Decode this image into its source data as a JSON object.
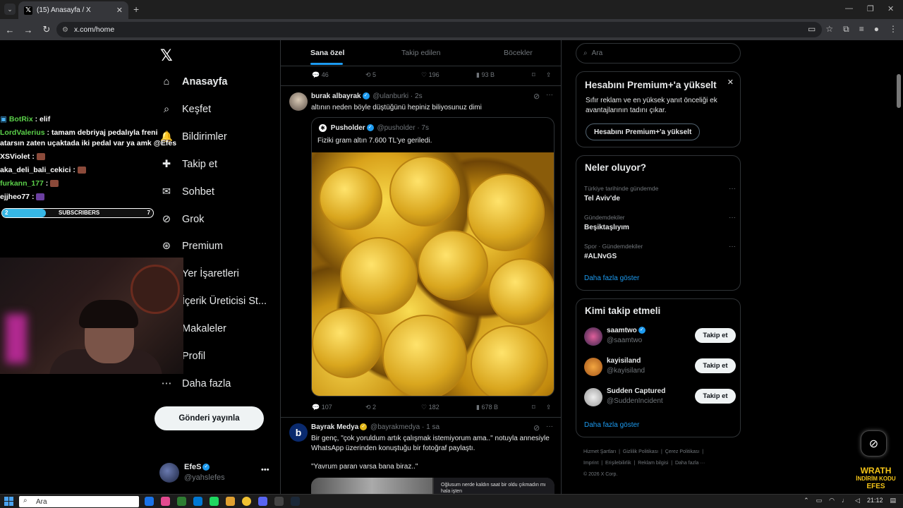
{
  "browser": {
    "tab_title": "(15) Anasayfa / X",
    "url_site": "⚙",
    "url": "x.com/home"
  },
  "overlay": {
    "chat": [
      {
        "user": "BotRix",
        "msg": ": elif"
      },
      {
        "user": "LordValerius",
        "msg": ": tamam debriyaj pedalıyla freni atarsın zaten uçaktada iki pedal var ya amk @Efes"
      },
      {
        "user": "XSViolet",
        "msg": ":"
      },
      {
        "user": "aka_deli_bali_cekici",
        "msg": ":"
      },
      {
        "user": "furkann_177",
        "msg": ":"
      },
      {
        "user": "ejjheo77",
        "msg": ":"
      }
    ],
    "subs_label": "SUBSCRIBERS",
    "subs_current": "2",
    "subs_goal": "7",
    "subs_progress": 0.29,
    "watermark": [
      "WRATH",
      "İNDİRİM KODU",
      "EFES"
    ]
  },
  "nav": {
    "items": [
      {
        "label": "Anasayfa",
        "icon": "home-icon"
      },
      {
        "label": "Keşfet",
        "icon": "search-icon"
      },
      {
        "label": "Bildirimler",
        "icon": "bell-icon"
      },
      {
        "label": "Takip et",
        "icon": "follow-icon"
      },
      {
        "label": "Sohbet",
        "icon": "mail-icon"
      },
      {
        "label": "Grok",
        "icon": "grok-icon"
      },
      {
        "label": "Premium",
        "icon": "premium-icon"
      },
      {
        "label": "Yer İşaretleri",
        "icon": "bookmark-icon"
      },
      {
        "label": "İçerik Üreticisi St...",
        "icon": "studio-icon"
      },
      {
        "label": "Makaleler",
        "icon": "article-icon"
      },
      {
        "label": "Profil",
        "icon": "profile-icon"
      },
      {
        "label": "Daha fazla",
        "icon": "more-icon"
      }
    ],
    "post_button": "Gönderi yayınla",
    "profile_name": "EfeS",
    "profile_handle": "@yahslefes"
  },
  "timeline": {
    "tabs": [
      "Sana özel",
      "Takip edilen",
      "Böcekler"
    ],
    "top_actions": {
      "replies": "46",
      "reposts": "5",
      "likes": "196",
      "views": "93 B"
    },
    "tweet1": {
      "name": "burak albayrak",
      "handle": "@ulanburki",
      "time": "· 2s",
      "text": "altının neden böyle düştüğünü hepiniz biliyosunuz dimi",
      "quote_name": "Pusholder",
      "quote_handle": "@pusholder",
      "quote_time": "· 7s",
      "quote_text": "Fiziki gram altın 7.600 TL'ye geriledi.",
      "replies": "107",
      "reposts": "2",
      "likes": "182",
      "views": "678 B"
    },
    "tweet2": {
      "name": "Bayrak Medya",
      "handle": "@bayrakmedya",
      "time": "· 1 sa",
      "text": "Bir genç, \"çok yoruldum artık çalışmak istemiyorum ama..\" notuyla annesiyle WhatsApp üzerinden konuştuğu bir fotoğraf paylaştı.",
      "text2": "\"Yavrum paran varsa bana biraz..\"",
      "img_caption": "Oğlusum nerde kaldın saat bir oldu çıkmadın mı hala işten"
    }
  },
  "sidebar": {
    "search_placeholder": "Ara",
    "premium_title": "Hesabını Premium+'a yükselt",
    "premium_text": "Sıfır reklam ve en yüksek yanıt önceliği ek avantajlarının tadını çıkar.",
    "premium_button": "Hesabını Premium+'a yükselt",
    "trends_title": "Neler oluyor?",
    "trends": [
      {
        "category": "Türkiye tarihinde gündemde",
        "name": "Tel Aviv'de"
      },
      {
        "category": "Gündemdekiler",
        "name": "Beşiktaşlıyım"
      },
      {
        "category": "Spor · Gündemdekiler",
        "name": "#ALNvGS"
      }
    ],
    "trends_more": "Daha fazla göster",
    "who_title": "Kimi takip etmeli",
    "who": [
      {
        "name": "saamtwo",
        "handle": "@saamtwo",
        "verified": true
      },
      {
        "name": "kayisiland",
        "handle": "@kayisiland",
        "verified": false
      },
      {
        "name": "Sudden Captured",
        "handle": "@SuddenIncident",
        "verified": false
      }
    ],
    "follow_label": "Takip et",
    "who_more": "Daha fazla göster",
    "footer": [
      "Hizmet Şartları",
      "Gizlilik Politikası",
      "Çerez Politikası",
      "Imprint",
      "Erişilebilirlik",
      "Reklam bilgisi",
      "Daha fazla ···",
      "© 2026 X Corp."
    ]
  },
  "taskbar": {
    "search_placeholder": "Ara",
    "time": "21:12"
  },
  "colors": {
    "accent": "#1d9bf0",
    "background": "#000000",
    "border": "#2f3336"
  }
}
